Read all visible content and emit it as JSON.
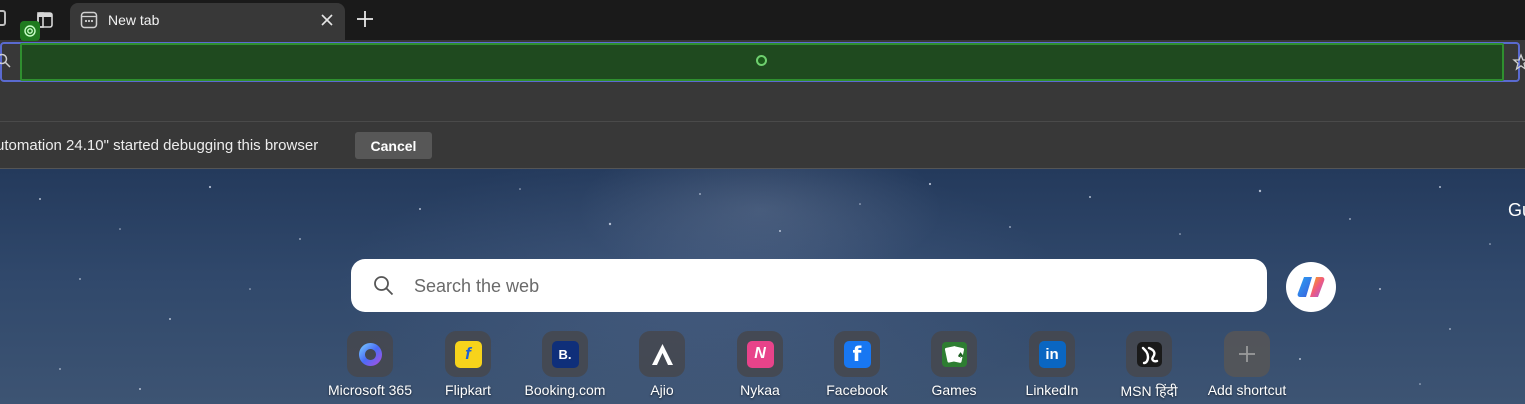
{
  "tabstrip": {
    "tabs": [
      {
        "title": "New tab",
        "active": true
      }
    ]
  },
  "infobar": {
    "message": "utomation 24.10\" started debugging this browser",
    "cancel_label": "Cancel"
  },
  "ntp": {
    "greeting": "Gu",
    "search_placeholder": "Search the web",
    "shortcuts": [
      {
        "label": "Microsoft 365",
        "icon": "microsoft-365-icon",
        "color": "#3a5bd9"
      },
      {
        "label": "Flipkart",
        "icon": "flipkart-icon",
        "color": "#f7d31b"
      },
      {
        "label": "Booking.com",
        "icon": "booking-icon",
        "color": "#0f2f7a",
        "glyph": "B."
      },
      {
        "label": "Ajio",
        "icon": "ajio-icon",
        "color": "#2b2b2b"
      },
      {
        "label": "Nykaa",
        "icon": "nykaa-icon",
        "color": "#e8438a"
      },
      {
        "label": "Facebook",
        "icon": "facebook-icon",
        "color": "#1877f2",
        "glyph": "f"
      },
      {
        "label": "Games",
        "icon": "games-icon",
        "color": "#2e7d32"
      },
      {
        "label": "LinkedIn",
        "icon": "linkedin-icon",
        "color": "#0a66c2",
        "glyph": "in"
      },
      {
        "label": "MSN हिंदी",
        "icon": "msn-hindi-icon",
        "color": "#1a1a1a"
      },
      {
        "label": "Add shortcut",
        "icon": "plus-icon",
        "color": "#5a5a5a"
      }
    ]
  },
  "colors": {
    "tabstrip_bg": "#1a1a1a",
    "toolbar_bg": "#383838",
    "automation_highlight": "#1f4a1f",
    "accent_border": "#5a6ad0"
  }
}
